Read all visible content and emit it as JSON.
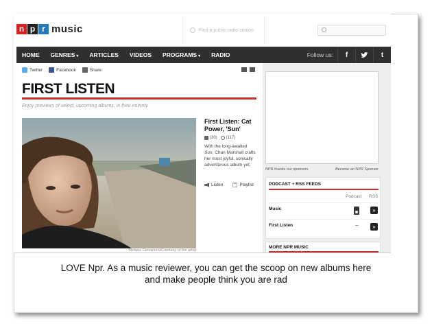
{
  "header": {
    "logo_letters": [
      "n",
      "p",
      "r"
    ],
    "logo_colors": [
      "#d62021",
      "#222222",
      "#237bbd"
    ],
    "logo_word": "music",
    "station_placeholder": "Find a public radio station"
  },
  "nav": {
    "items": [
      {
        "label": "HOME",
        "dropdown": false
      },
      {
        "label": "GENRES",
        "dropdown": true
      },
      {
        "label": "ARTICLES",
        "dropdown": false
      },
      {
        "label": "VIDEOS",
        "dropdown": false
      },
      {
        "label": "PROGRAMS",
        "dropdown": true
      },
      {
        "label": "RADIO",
        "dropdown": false
      }
    ],
    "follow_label": "Follow us:",
    "social": [
      "f",
      "t"
    ]
  },
  "share": {
    "twitter": "Twitter",
    "facebook": "Facebook",
    "share": "Share"
  },
  "main": {
    "title": "FIRST LISTEN",
    "tagline": "Enjoy previews of select, upcoming albums, in their entirety.",
    "photo_credit": "Stefano Giovannini/Courtesy of the artist",
    "story": {
      "title": "First Listen: Cat Power, 'Sun'",
      "comments": "(30)",
      "recommends": "(117)",
      "teaser_pre": "With the long-awaited",
      "teaser_album": "Sun",
      "teaser_post": ", Chan Marshall crafts her most joyful, sonically adventurous album yet.",
      "listen": "Listen",
      "playlist": "Playlist"
    }
  },
  "right": {
    "sponsor_left": "NPR thanks our sponsors",
    "sponsor_right": "Become an NPR Sponsor",
    "podcast_title": "PODCAST + RSS FEEDS",
    "col_podcast": "Podcast",
    "col_rss": "RSS",
    "feeds": [
      {
        "name": "Music",
        "has_podcast": true
      },
      {
        "name": "First Listen",
        "has_podcast": false
      }
    ],
    "no_podcast_mark": "–",
    "more_title": "MORE NPR MUSIC"
  },
  "caption": {
    "line1": "LOVE Npr. As a music reviewer, you can get the scoop on new albums here",
    "line2": "and make people think you are rad"
  }
}
